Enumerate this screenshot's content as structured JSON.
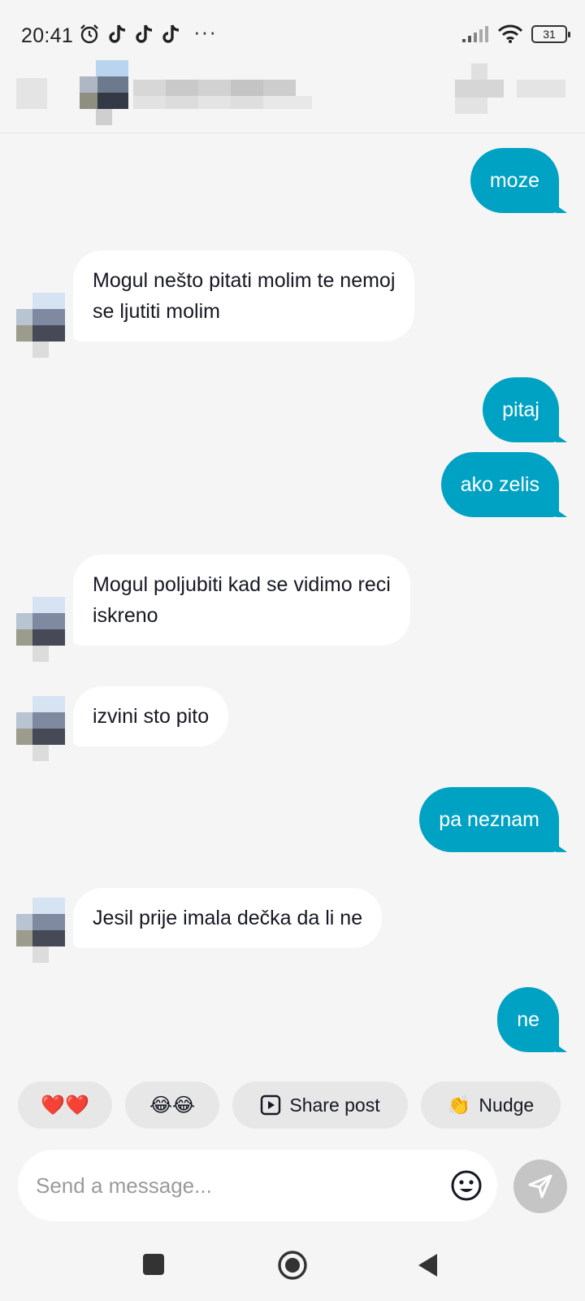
{
  "status_bar": {
    "time": "20:41",
    "more_indicator": "···",
    "battery_level": "31",
    "left_icons": [
      "alarm-icon",
      "tiktok-icon",
      "tiktok-icon",
      "tiktok-icon"
    ],
    "right_icons": [
      "signal-icon",
      "wifi-icon",
      "battery-icon"
    ]
  },
  "header": {
    "contact_name_obscured": true
  },
  "messages": [
    {
      "direction": "out",
      "text": "moze"
    },
    {
      "direction": "in",
      "lines": [
        "Mogul nešto pitati molim te nemoj",
        "se ljutiti molim"
      ]
    },
    {
      "direction": "out",
      "text": "pitaj"
    },
    {
      "direction": "out",
      "text": "ako zelis"
    },
    {
      "direction": "in",
      "lines": [
        "Mogul poljubiti kad se vidimo reci",
        "iskreno"
      ]
    },
    {
      "direction": "in",
      "lines": [
        "izvini sto pito"
      ]
    },
    {
      "direction": "out",
      "text": "pa neznam"
    },
    {
      "direction": "in",
      "lines": [
        "Jesil prije imala dečka da li ne"
      ]
    },
    {
      "direction": "out",
      "text": "ne"
    }
  ],
  "quick_replies": {
    "hearts": "❤️❤️",
    "laugh": "😂😂",
    "share_post": "Share post",
    "nudge": "Nudge",
    "nudge_emoji": "👏"
  },
  "composer": {
    "placeholder": "Send a message...",
    "value": ""
  },
  "colors": {
    "outgoing_bubble": "#00a2c4",
    "incoming_bubble": "#ffffff",
    "background": "#f5f5f5",
    "chip": "#e7e7e7",
    "send_button_disabled": "#c5c5c5"
  }
}
